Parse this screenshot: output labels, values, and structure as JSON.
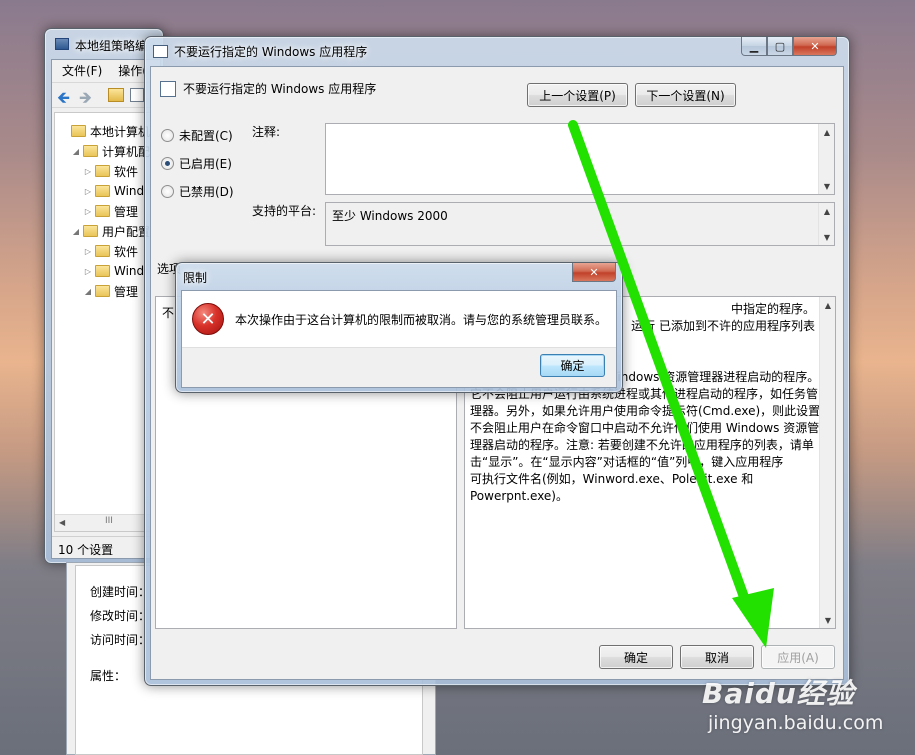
{
  "back_window": {
    "title": "本地组策略编",
    "menu": [
      "文件(F)",
      "操作("
    ],
    "tree": [
      {
        "label": "本地计算机",
        "indent": 0,
        "expander": ""
      },
      {
        "label": "计算机配",
        "indent": 1,
        "expander": "◢"
      },
      {
        "label": "软件",
        "indent": 2,
        "expander": "▷"
      },
      {
        "label": "Wind",
        "indent": 2,
        "expander": "▷"
      },
      {
        "label": "管理",
        "indent": 2,
        "expander": "▷"
      },
      {
        "label": "用户配置",
        "indent": 1,
        "expander": "◢"
      },
      {
        "label": "软件",
        "indent": 2,
        "expander": "▷"
      },
      {
        "label": "Wind",
        "indent": 2,
        "expander": "▷"
      },
      {
        "label": "管理",
        "indent": 2,
        "expander": "◢"
      }
    ],
    "status": "10 个设置",
    "hscroll_thumb": "III"
  },
  "props_panel": {
    "created": "创建时间：",
    "modified": "修改时间：",
    "accessed": "访问时间：",
    "attributes": "属性："
  },
  "main_dialog": {
    "title": "不要运行指定的 Windows 应用程序",
    "header_title": "不要运行指定的 Windows 应用程序",
    "prev_button": "上一个设置(P)",
    "next_button": "下一个设置(N)",
    "radio_not_configured": "未配置(C)",
    "radio_enabled": "已启用(E)",
    "radio_disabled": "已禁用(D)",
    "comment_label": "注释:",
    "platform_label": "支持的平台:",
    "platform_value": "至少 Windows 2000",
    "options_label": "选项",
    "options_frag": "不",
    "desc_lines": [
      "中指定的程序。",
      "运行 已添加到不许的应用程序列表",
      "",
      "",
      "此设置只阻止用户运行由 Windows 资源管理器进程启动的程序。",
      "它不会阻止用户运行由系统进程或其他进程启动的程序，如任务管",
      "理器。另外，如果允许用户使用命令提示符(Cmd.exe)，则此设置",
      "不会阻止用户在命令窗口中启动不允许他们使用 Windows 资源管",
      "理器启动的程序。注意: 若要创建不允许的应用程序的列表，请单",
      "击“显示”。在“显示内容”对话框的“值”列中，键入应用程序",
      "可执行文件名(例如，Winword.exe、Poledit.exe 和",
      "Powerpnt.exe)。"
    ],
    "ok_button": "确定",
    "cancel_button": "取消",
    "apply_button": "应用(A)"
  },
  "alert": {
    "title": "限制",
    "message": "本次操作由于这台计算机的限制而被取消。请与您的系统管理员联系。",
    "ok_button": "确定"
  },
  "watermark": {
    "brand": "Baidu经验",
    "url": "jingyan.baidu.com"
  },
  "colors": {
    "arrow": "#22e000",
    "error_red": "#c8201c"
  }
}
